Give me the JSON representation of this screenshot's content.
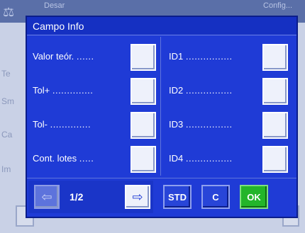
{
  "background": {
    "title": "Desar",
    "title2": "Config...",
    "side_items": [
      "Te",
      "Sm",
      "Ca",
      "Im"
    ]
  },
  "dialog": {
    "title": "Campo Info",
    "left_fields": [
      {
        "label": "Valor teór.",
        "dots": "......"
      },
      {
        "label": "Tol+",
        "dots": ".............."
      },
      {
        "label": "Tol-",
        "dots": ".............."
      },
      {
        "label": "Cont. lotes",
        "dots": "....."
      }
    ],
    "right_fields": [
      {
        "label": "ID1",
        "dots": "................"
      },
      {
        "label": "ID2",
        "dots": "................"
      },
      {
        "label": "ID3",
        "dots": "................"
      },
      {
        "label": "ID4",
        "dots": "................"
      }
    ],
    "page_indicator": "1/2",
    "buttons": {
      "prev": "⇦",
      "next": "⇨",
      "std": "STD",
      "c": "C",
      "ok": "OK"
    }
  },
  "colors": {
    "dialog_bg": "#1f3bd6",
    "ok_green": "#23b52a"
  }
}
